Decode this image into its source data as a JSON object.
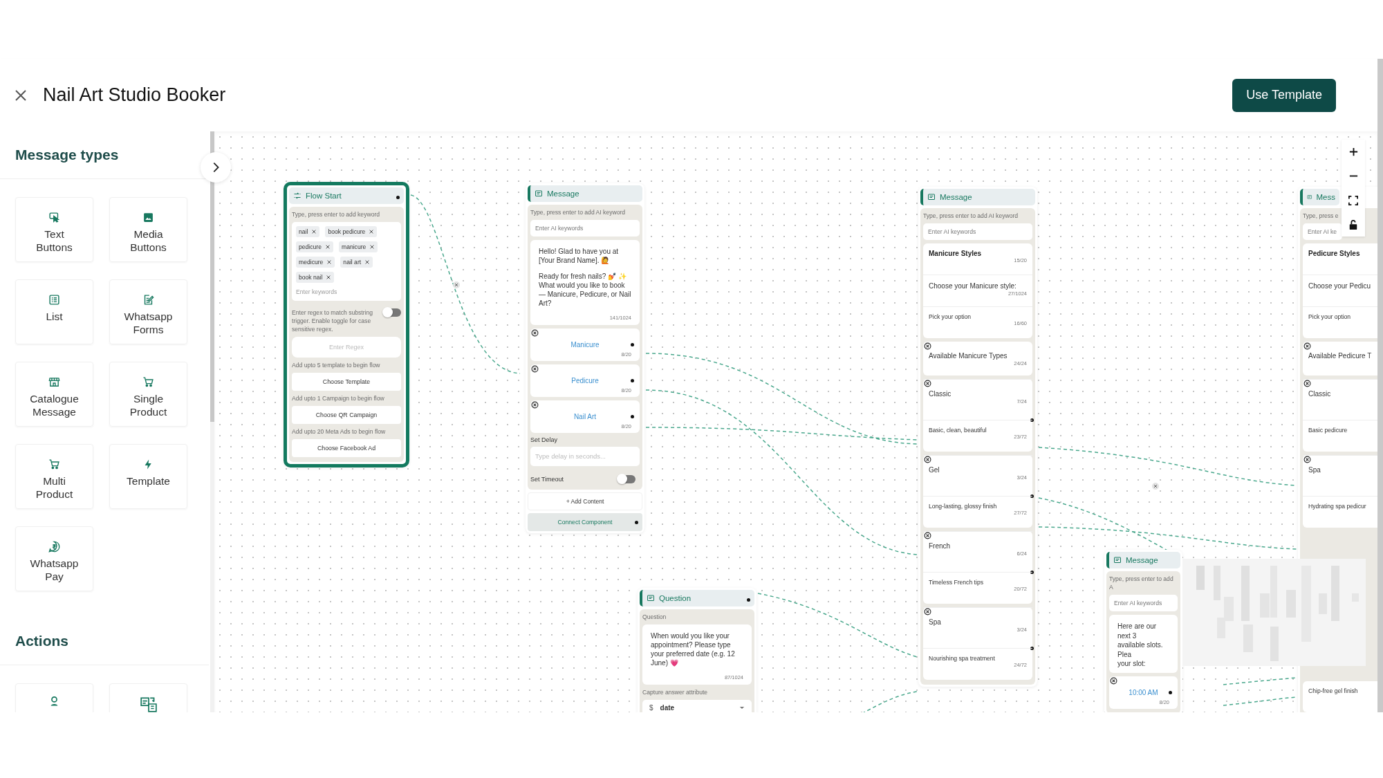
{
  "header": {
    "title": "Nail Art Studio Booker",
    "button": "Use Template"
  },
  "sidebar": {
    "title": "Message types",
    "items": [
      {
        "label": "Text Buttons"
      },
      {
        "label": "Media Buttons"
      },
      {
        "label": "List"
      },
      {
        "label": "Whatsapp Forms"
      },
      {
        "label": "Catalogue Message"
      },
      {
        "label": "Single Product"
      },
      {
        "label": "Multi Product"
      },
      {
        "label": "Template"
      },
      {
        "label": "Whatsapp Pay"
      }
    ],
    "actions_title": "Actions"
  },
  "canvas": {
    "nodes": [
      {
        "kind": "flow_start",
        "title": "Flow Start",
        "keyword_hint": "Type, press enter to add keyword",
        "keywords": [
          "nail",
          "book pedicure",
          "pedicure",
          "manicure",
          "medicure",
          "nail art",
          "book nail"
        ],
        "keyword_placeholder": "Enter keywords",
        "regex_hint": "Enter regex to match substring trigger. Enable toggle for case sensitive regex.",
        "regex_toggle_on": false,
        "regex_placeholder": "Enter Regex",
        "starters": [
          {
            "hint": "Add upto 5 template to begin flow",
            "button": "Choose Template"
          },
          {
            "hint": "Add upto 1 Campaign to begin flow",
            "button": "Choose QR Campaign"
          },
          {
            "hint": "Add upto 20 Meta Ads to begin flow",
            "button": "Choose Facebook Ad"
          }
        ]
      },
      {
        "kind": "message",
        "title": "Message",
        "ai_hint": "Type, press enter to add AI keyword",
        "ai_placeholder": "Enter AI keywords",
        "body": [
          "Hello! Glad to have you at [Your Brand Name]. 🙋",
          "Ready for fresh nails? 💅 ✨ What would you like to book — Manicure, Pedicure, or Nail Art?"
        ],
        "body_count": "141/1024",
        "buttons": [
          {
            "label": "Manicure",
            "count": "8/20"
          },
          {
            "label": "Pedicure",
            "count": "8/20"
          },
          {
            "label": "Nail Art",
            "count": "8/20"
          }
        ],
        "delay_label": "Set Delay",
        "delay_placeholder": "Type delay in seconds...",
        "timeout_label": "Set Timeout",
        "timeout_on": false,
        "add_content": "+ Add Content",
        "connect": "Connect Component"
      },
      {
        "kind": "question",
        "title": "Question",
        "label": "Question",
        "body": "When would you like your appointment? Please type your preferred date (e.g. 12 June) 💗",
        "body_count": "87/1024",
        "attribute_label": "Capture answer attribute",
        "attribute_prefix": "$",
        "attribute_value": "date"
      },
      {
        "kind": "list",
        "title": "Message",
        "ai_hint": "Type, press enter to add AI keyword",
        "ai_placeholder": "Enter AI keywords",
        "heading": "Manicure Styles",
        "heading_count": "15/20",
        "body": "Choose your Manicure style:",
        "body_count": "27/1024",
        "footer": "Pick your option",
        "footer_count": "16/60",
        "section_title": "Available Manicure Types",
        "section_count": "24/24",
        "rows": [
          {
            "title": "Classic",
            "title_count": "7/24",
            "description": "Basic, clean, beautiful",
            "description_count": "23/72"
          },
          {
            "title": "Gel",
            "title_count": "3/24",
            "description": "Long-lasting, glossy finish",
            "description_count": "27/72"
          },
          {
            "title": "French",
            "title_count": "6/24",
            "description": "Timeless French tips",
            "description_count": "20/72"
          },
          {
            "title": "Spa",
            "title_count": "3/24",
            "description": "Nourishing spa treatment",
            "description_count": "24/72"
          }
        ]
      },
      {
        "kind": "message",
        "title": "Message",
        "ai_hint": "Type, press enter to add A",
        "ai_placeholder": "Enter AI keywords",
        "body_lines": [
          "Here are our next 3",
          "available slots. Plea",
          "your slot:"
        ],
        "buttons": [
          {
            "label": "10:00 AM",
            "count": "8/20"
          }
        ]
      },
      {
        "kind": "list",
        "title": "Mess",
        "ai_hint": "Type, press e",
        "ai_placeholder": "Enter AI ke",
        "heading": "Pedicure Styles",
        "body": "Choose your Pedicu",
        "footer": "Pick your option",
        "section_title": "Available Pedicure T",
        "rows": [
          {
            "title": "Classic",
            "description": "Basic pedicure"
          },
          {
            "title": "Spa",
            "description": "Hydrating spa pedicur"
          },
          {
            "description": "Chip-free gel finish"
          }
        ]
      }
    ]
  }
}
